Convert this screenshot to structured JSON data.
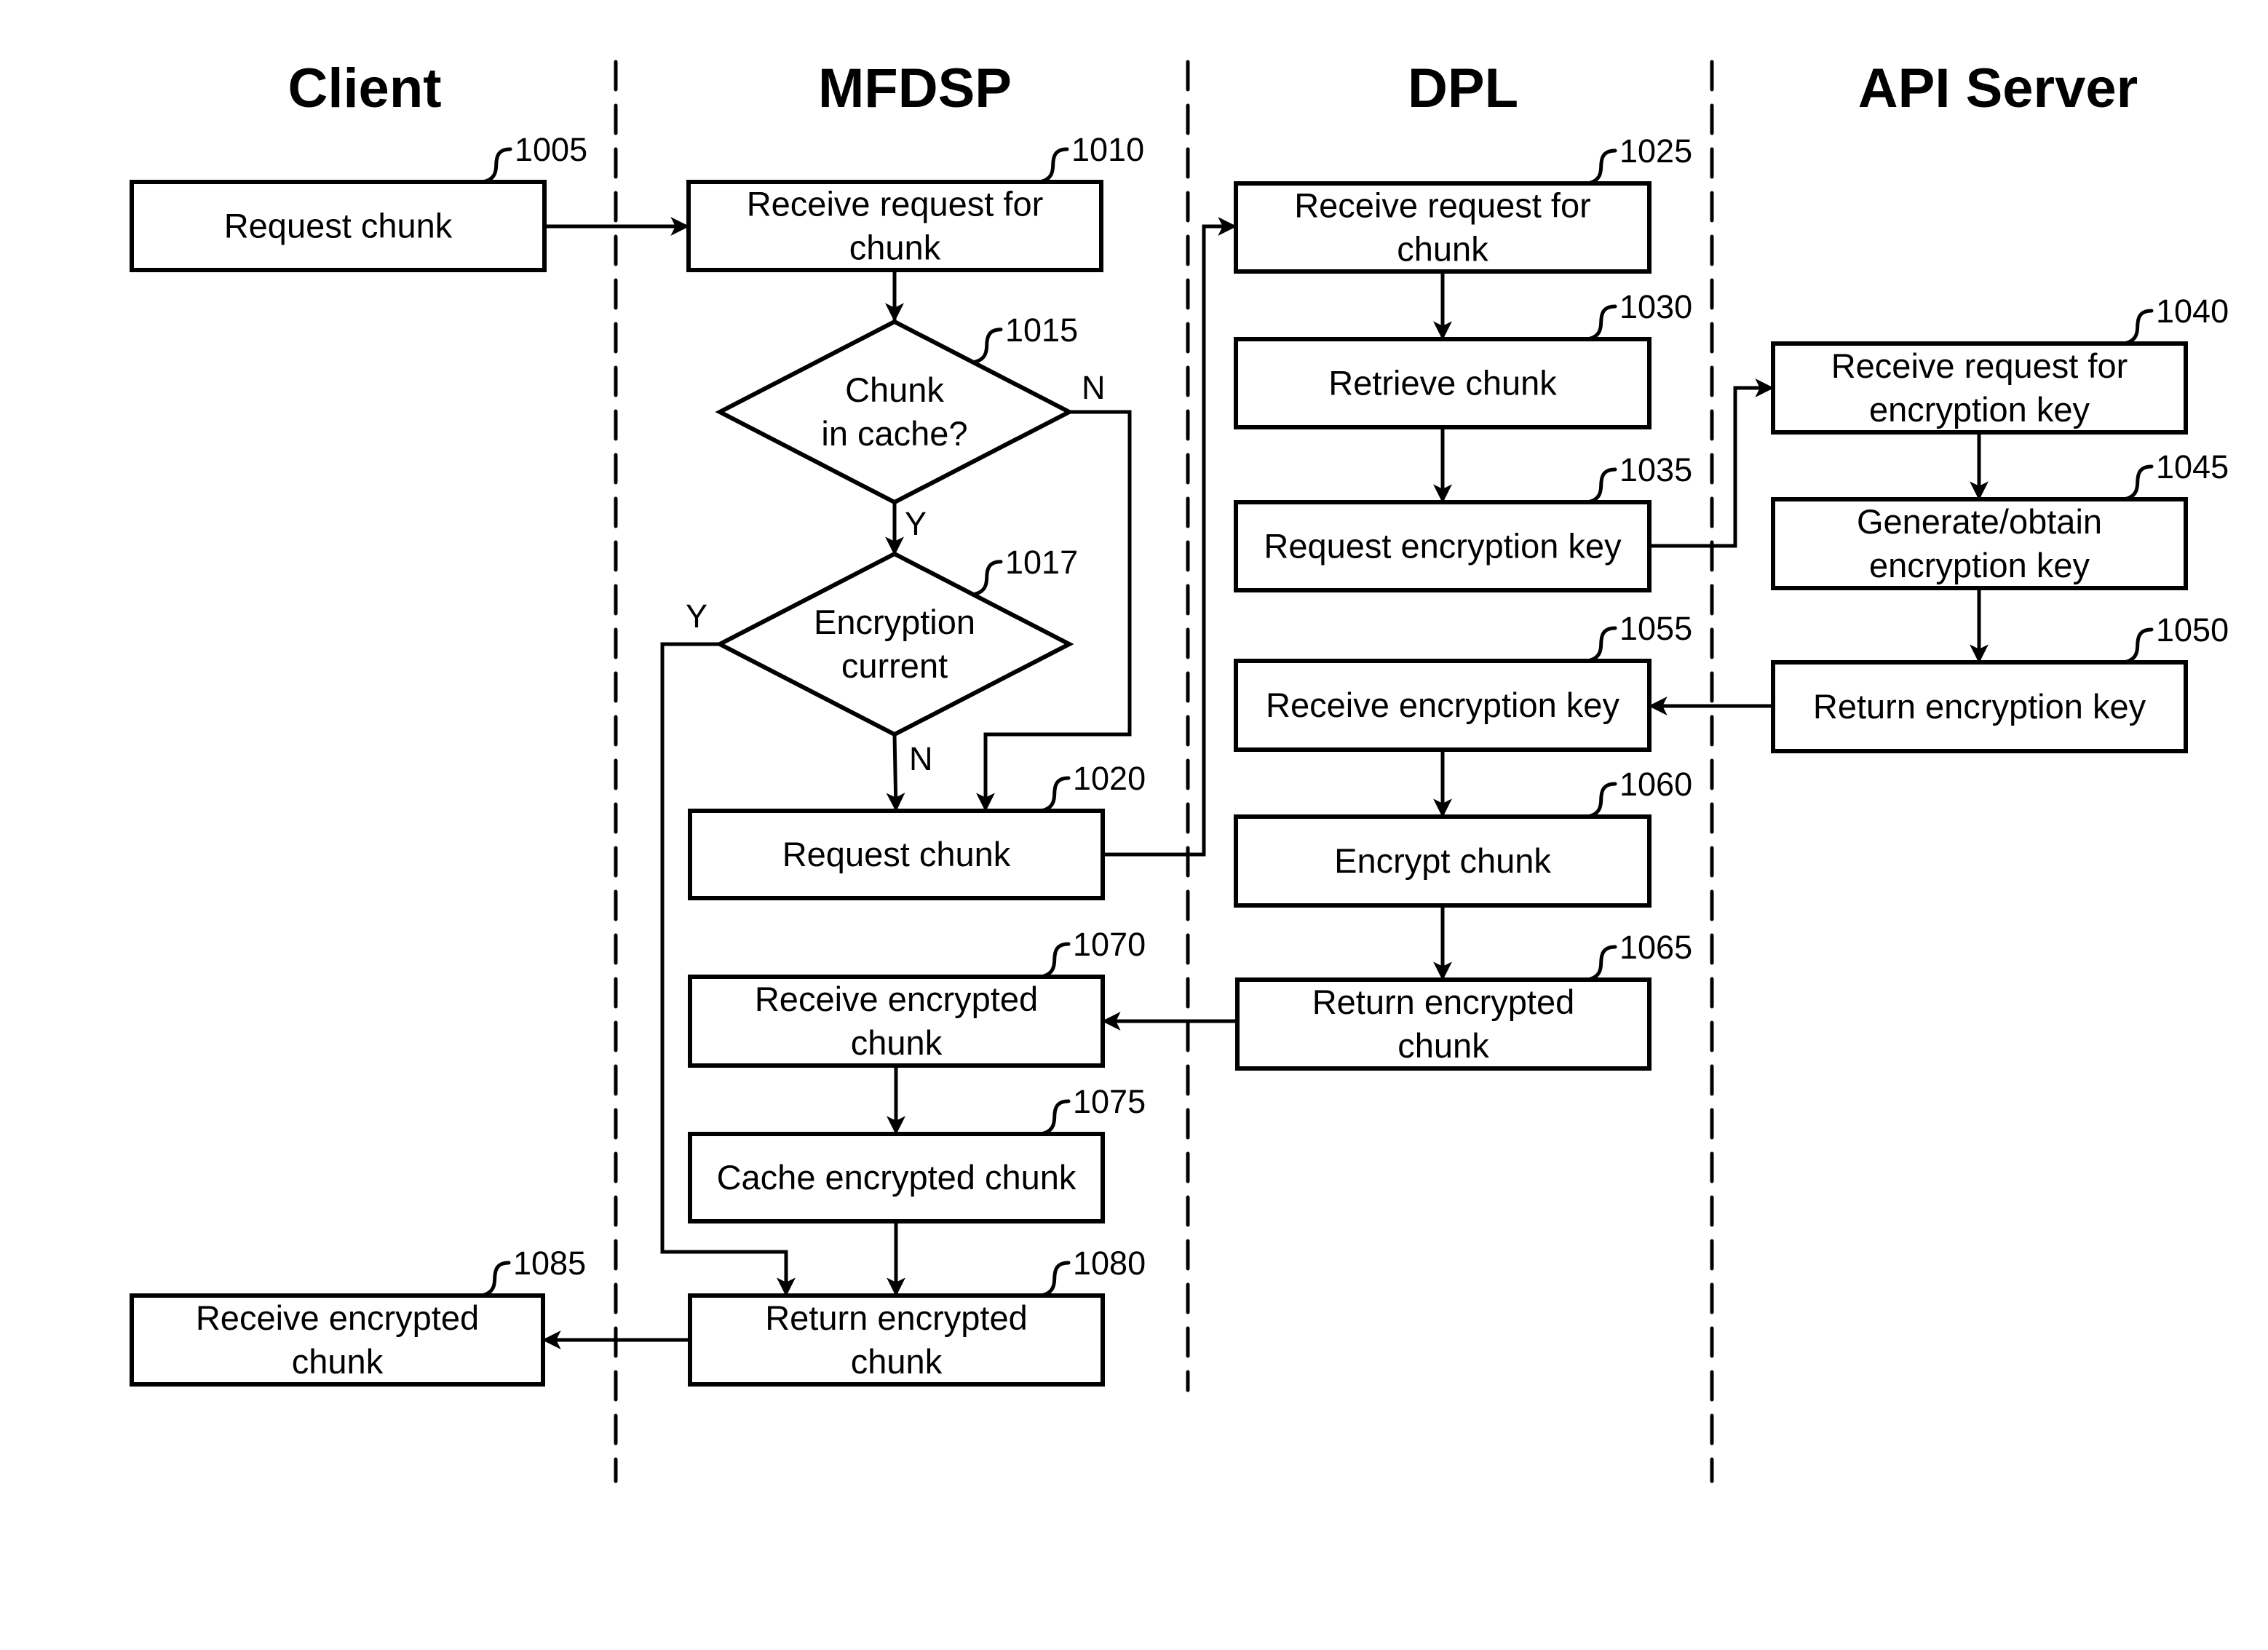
{
  "lanes": [
    {
      "id": "client",
      "title": "Client"
    },
    {
      "id": "mfdsp",
      "title": "MFDSP"
    },
    {
      "id": "dpl",
      "title": "DPL"
    },
    {
      "id": "api",
      "title": "API Server"
    }
  ],
  "steps": {
    "s1005": {
      "ref": "1005",
      "lane": "client",
      "type": "process",
      "lines": [
        "Request chunk"
      ]
    },
    "s1010": {
      "ref": "1010",
      "lane": "mfdsp",
      "type": "process",
      "lines": [
        "Receive request for",
        "chunk"
      ]
    },
    "s1015": {
      "ref": "1015",
      "lane": "mfdsp",
      "type": "decision",
      "lines": [
        "Chunk",
        "in cache?"
      ]
    },
    "s1017": {
      "ref": "1017",
      "lane": "mfdsp",
      "type": "decision",
      "lines": [
        "Encryption",
        "current"
      ]
    },
    "s1020": {
      "ref": "1020",
      "lane": "mfdsp",
      "type": "process",
      "lines": [
        "Request chunk"
      ]
    },
    "s1025": {
      "ref": "1025",
      "lane": "dpl",
      "type": "process",
      "lines": [
        "Receive request for",
        "chunk"
      ]
    },
    "s1030": {
      "ref": "1030",
      "lane": "dpl",
      "type": "process",
      "lines": [
        "Retrieve chunk"
      ]
    },
    "s1035": {
      "ref": "1035",
      "lane": "dpl",
      "type": "process",
      "lines": [
        "Request encryption key"
      ]
    },
    "s1040": {
      "ref": "1040",
      "lane": "api",
      "type": "process",
      "lines": [
        "Receive request for",
        "encryption key"
      ]
    },
    "s1045": {
      "ref": "1045",
      "lane": "api",
      "type": "process",
      "lines": [
        "Generate/obtain",
        "encryption key"
      ]
    },
    "s1050": {
      "ref": "1050",
      "lane": "api",
      "type": "process",
      "lines": [
        "Return encryption key"
      ]
    },
    "s1055": {
      "ref": "1055",
      "lane": "dpl",
      "type": "process",
      "lines": [
        "Receive encryption key"
      ]
    },
    "s1060": {
      "ref": "1060",
      "lane": "dpl",
      "type": "process",
      "lines": [
        "Encrypt chunk"
      ]
    },
    "s1065": {
      "ref": "1065",
      "lane": "dpl",
      "type": "process",
      "lines": [
        "Return encrypted",
        "chunk"
      ]
    },
    "s1070": {
      "ref": "1070",
      "lane": "mfdsp",
      "type": "process",
      "lines": [
        "Receive encrypted",
        "chunk"
      ]
    },
    "s1075": {
      "ref": "1075",
      "lane": "mfdsp",
      "type": "process",
      "lines": [
        "Cache encrypted chunk"
      ]
    },
    "s1080": {
      "ref": "1080",
      "lane": "mfdsp",
      "type": "process",
      "lines": [
        "Return encrypted",
        "chunk"
      ]
    },
    "s1085": {
      "ref": "1085",
      "lane": "client",
      "type": "process",
      "lines": [
        "Receive encrypted",
        "chunk"
      ]
    }
  },
  "branch_labels": {
    "d1015_no": "N",
    "d1015_yes": "Y",
    "d1017_yes": "Y",
    "d1017_no": "N"
  },
  "flows": [
    {
      "from": "1005",
      "to": "1010"
    },
    {
      "from": "1010",
      "to": "1015"
    },
    {
      "from": "1015",
      "to": "1017",
      "label": "Y"
    },
    {
      "from": "1015",
      "to": "1020",
      "label": "N"
    },
    {
      "from": "1017",
      "to": "1020",
      "label": "N"
    },
    {
      "from": "1017",
      "to": "1080",
      "label": "Y"
    },
    {
      "from": "1020",
      "to": "1025"
    },
    {
      "from": "1025",
      "to": "1030"
    },
    {
      "from": "1030",
      "to": "1035"
    },
    {
      "from": "1035",
      "to": "1040"
    },
    {
      "from": "1040",
      "to": "1045"
    },
    {
      "from": "1045",
      "to": "1050"
    },
    {
      "from": "1050",
      "to": "1055"
    },
    {
      "from": "1055",
      "to": "1060"
    },
    {
      "from": "1060",
      "to": "1065"
    },
    {
      "from": "1065",
      "to": "1070"
    },
    {
      "from": "1070",
      "to": "1075"
    },
    {
      "from": "1075",
      "to": "1080"
    },
    {
      "from": "1080",
      "to": "1085"
    }
  ]
}
